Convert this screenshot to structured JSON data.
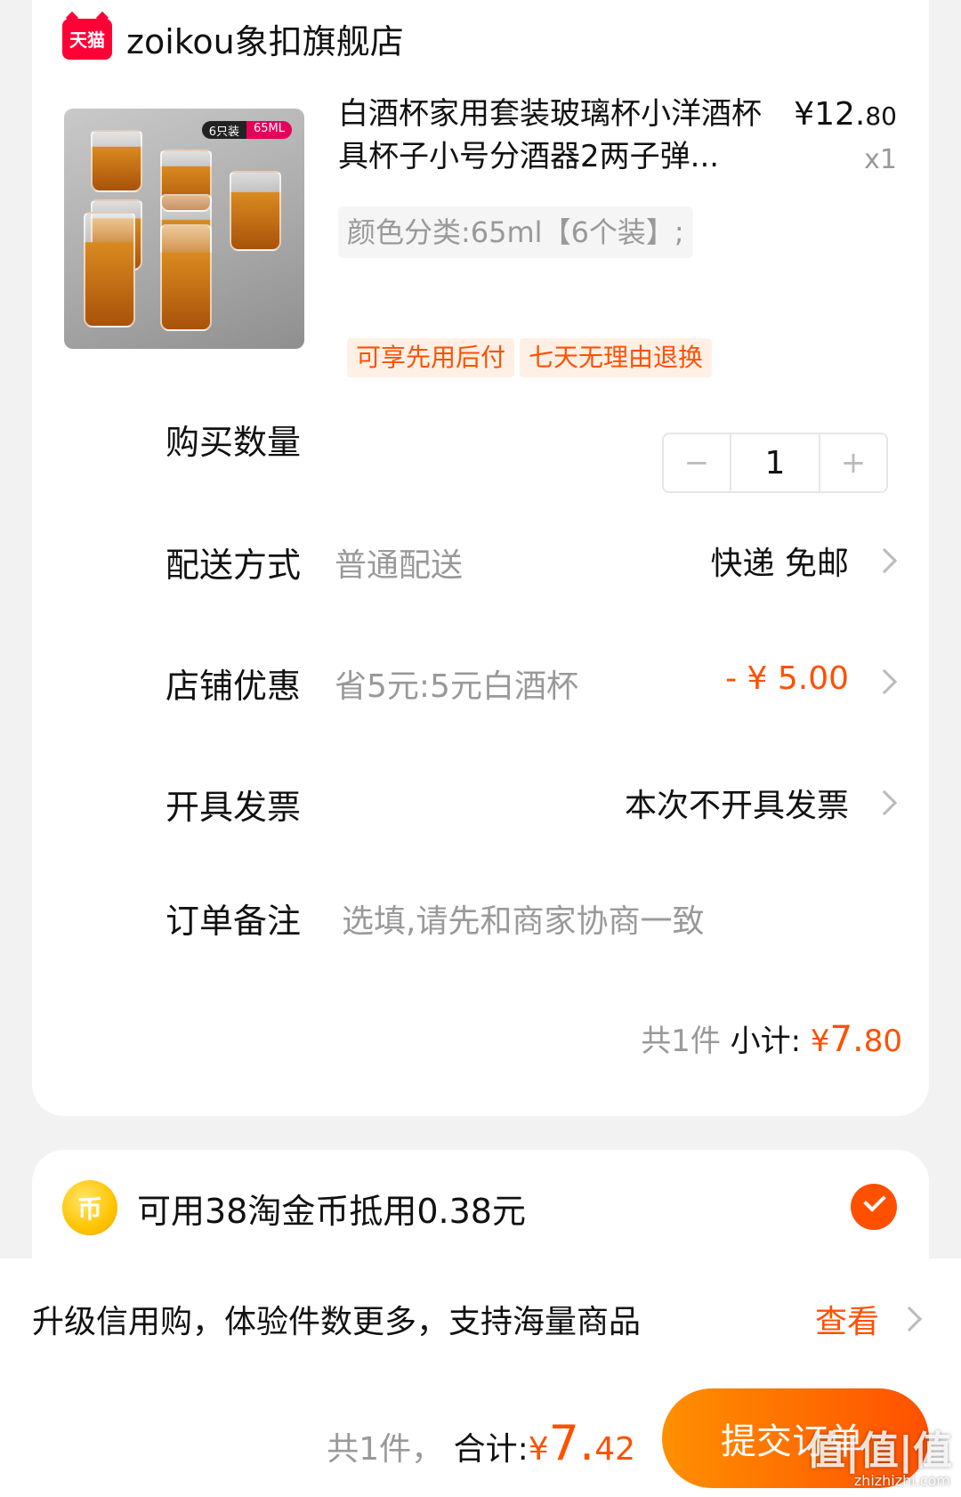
{
  "shop": {
    "logo_text": "天猫",
    "name": "zoikou象扣旗舰店"
  },
  "product": {
    "title": "白酒杯家用套装玻璃杯小洋酒杯具杯子小号分酒器2两子弹...",
    "price_currency": "¥",
    "price_int": "12.",
    "price_dec": "80",
    "quantity": "x1",
    "spec": "颜色分类:65ml【6个装】;",
    "badge_count": "6只装",
    "badge_volume": "65ML",
    "tags": [
      "可享先用后付",
      "七天无理由退换"
    ]
  },
  "rows": {
    "qty_label": "购买数量",
    "qty_value": "1",
    "qty_minus": "−",
    "qty_plus": "+",
    "delivery_label": "配送方式",
    "delivery_sub": "普通配送",
    "delivery_value": "快递 免邮",
    "discount_label": "店铺优惠",
    "discount_sub": "省5元:5元白酒杯",
    "discount_value": "- ¥ 5.00",
    "invoice_label": "开具发票",
    "invoice_value": "本次不开具发票",
    "note_label": "订单备注",
    "note_placeholder": "选填,请先和商家协商一致"
  },
  "subtotal": {
    "count": "共1件",
    "label": "小计:",
    "currency": "¥",
    "int": "7.",
    "dec": "80"
  },
  "coin": {
    "icon_glyph": "币",
    "text": "可用38淘金币抵用0.38元",
    "checked": true
  },
  "promo": {
    "text": "升级信用购，体验件数更多，支持海量商品",
    "link": "查看"
  },
  "footer": {
    "count": "共1件，",
    "label": "合计:",
    "currency": "¥",
    "int": "7.",
    "dec": "42",
    "submit_label": "提交订单"
  },
  "watermark": {
    "text": "值|值|值",
    "url": "zhizhizhi.com"
  },
  "colors": {
    "accent": "#ff5000",
    "tmall_red": "#ff0036",
    "muted_text": "#999999"
  }
}
